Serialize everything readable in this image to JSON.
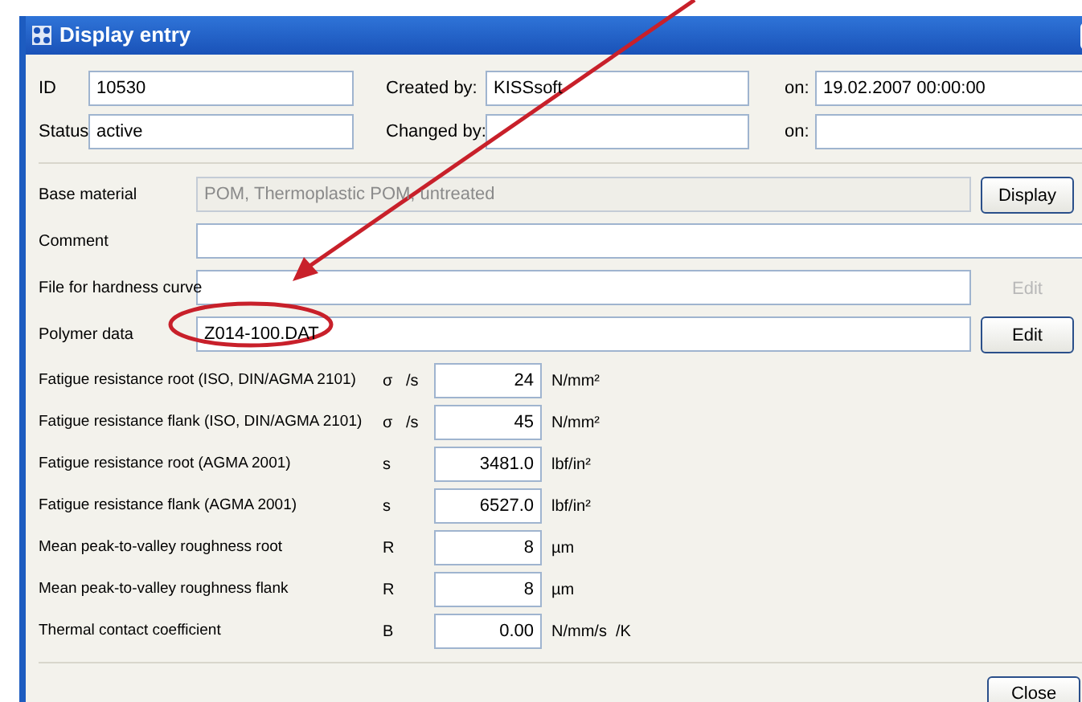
{
  "window": {
    "title": "Display entry"
  },
  "record": [
    [
      {
        "label": "ID",
        "value": "10530"
      },
      {
        "label": "Created by:",
        "value": "KISSsoft"
      },
      {
        "label": "on:",
        "value": "19.02.2007  00:00:00"
      }
    ],
    [
      {
        "label": "Status",
        "value": "active"
      },
      {
        "label": "Changed by:"
      },
      {
        "label": "on:"
      }
    ]
  ],
  "files": [
    {
      "label": "Base material",
      "value": "POM, Thermoplastic POM, untreated",
      "disabled": true,
      "button": {
        "label": "Display",
        "disabled": false
      }
    },
    {
      "label": "Comment",
      "disabled": false
    },
    {
      "label": "File for hardness curve",
      "disabled": false,
      "button": {
        "label": "Edit",
        "disabled": true
      }
    },
    {
      "label": "Polymer data",
      "value": "Z014-100.DAT",
      "disabled": false,
      "button": {
        "label": "Edit",
        "disabled": false
      }
    }
  ],
  "properties": [
    {
      "label": "Fatigue resistance root (ISO, DIN/AGMA 2101)",
      "symbol": "σ   /s",
      "value": "24",
      "unit": "N/mm²"
    },
    {
      "label": "Fatigue resistance flank (ISO, DIN/AGMA 2101)",
      "symbol": "σ   /s",
      "value": "45",
      "unit": "N/mm²"
    },
    {
      "label": "Fatigue resistance root (AGMA 2001)",
      "symbol": "s",
      "value": "3481.0",
      "unit": "lbf/in²"
    },
    {
      "label": "Fatigue resistance flank (AGMA 2001)",
      "symbol": "s",
      "value": "6527.0",
      "unit": "lbf/in²"
    },
    {
      "label": "Mean peak-to-valley roughness root",
      "symbol": "R",
      "value": "8",
      "unit": "µm"
    },
    {
      "label": "Mean peak-to-valley roughness flank",
      "symbol": "R",
      "value": "8",
      "unit": "µm"
    },
    {
      "label": "Thermal contact coefficient",
      "symbol": "B",
      "value": "0.00",
      "unit": "N/mm/s  /K"
    }
  ],
  "buttons": [
    "Close"
  ]
}
